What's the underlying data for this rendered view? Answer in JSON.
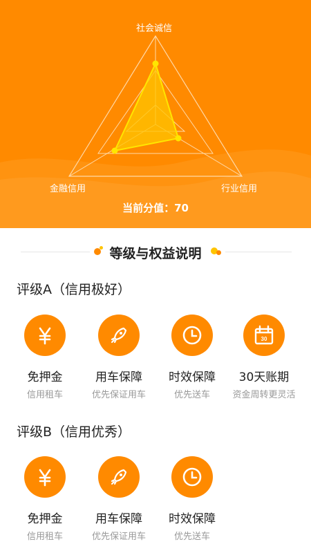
{
  "colors": {
    "accent": "#ff8a00",
    "highlight": "#ffe600",
    "white": "#ffffff"
  },
  "radar": {
    "axes": [
      "社会诚信",
      "金融信用",
      "行业信用"
    ],
    "score_text": "当前分值：70"
  },
  "section_title": "等级与权益说明",
  "grades": [
    {
      "title": "评级A（信用极好）",
      "benefits": [
        {
          "icon": "yen-icon",
          "name": "免押金",
          "desc": "信用租车"
        },
        {
          "icon": "rocket-icon",
          "name": "用车保障",
          "desc": "优先保证用车"
        },
        {
          "icon": "clock-icon",
          "name": "时效保障",
          "desc": "优先送车"
        },
        {
          "icon": "calendar-icon",
          "name": "30天账期",
          "desc": "资金周转更灵活",
          "badge": "30"
        }
      ]
    },
    {
      "title": "评级B（信用优秀）",
      "benefits": [
        {
          "icon": "yen-icon",
          "name": "免押金",
          "desc": "信用租车"
        },
        {
          "icon": "rocket-icon",
          "name": "用车保障",
          "desc": "优先保证用车"
        },
        {
          "icon": "clock-icon",
          "name": "时效保障",
          "desc": "优先送车"
        }
      ]
    }
  ]
}
